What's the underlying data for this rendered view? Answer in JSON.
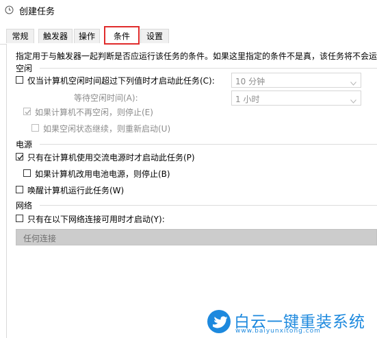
{
  "window": {
    "title": "创建任务",
    "icon": "clock-icon"
  },
  "tabs": [
    {
      "label": "常规",
      "active": false
    },
    {
      "label": "触发器",
      "active": false
    },
    {
      "label": "操作",
      "active": false
    },
    {
      "label": "条件",
      "active": true
    },
    {
      "label": "设置",
      "active": false
    }
  ],
  "description": "指定用于与触发器一起判断是否应运行该任务的条件。如果这里指定的条件不是真，该任务将不会运",
  "idle": {
    "section_label": "空闲",
    "start_only_if_idle": {
      "label": "仅当计算机空闲时间超过下列值时才启动此任务(C):",
      "checked": false
    },
    "idle_duration": "10 分钟",
    "wait_label": "等待空闲时间(A):",
    "wait_value": "1 小时",
    "stop_if_not_idle": {
      "label": "如果计算机不再空闲，则停止(E)",
      "checked": true,
      "enabled": false
    },
    "restart_if_idle_resumes": {
      "label": "如果空闲状态继续，则重新启动(U)",
      "checked": false,
      "enabled": false
    }
  },
  "power": {
    "section_label": "电源",
    "ac_only": {
      "label": "只有在计算机使用交流电源时才启动此任务(P)",
      "checked": true
    },
    "stop_on_battery": {
      "label": "如果计算机改用电池电源，则停止(B)",
      "checked": false
    },
    "wake_to_run": {
      "label": "唤醒计算机运行此任务(W)",
      "checked": false
    }
  },
  "network": {
    "section_label": "网络",
    "only_if_network": {
      "label": "只有在以下网络连接可用时才启动(Y):",
      "checked": false
    },
    "connection_value": "任何连接"
  },
  "watermark": {
    "brand": "白云一键重装系统",
    "url": "www.baiyunxitong.com"
  },
  "colors": {
    "tab_highlight": "#e02b2b",
    "brand_blue": "#1d89de",
    "disabled_text": "#8c8c8c"
  }
}
